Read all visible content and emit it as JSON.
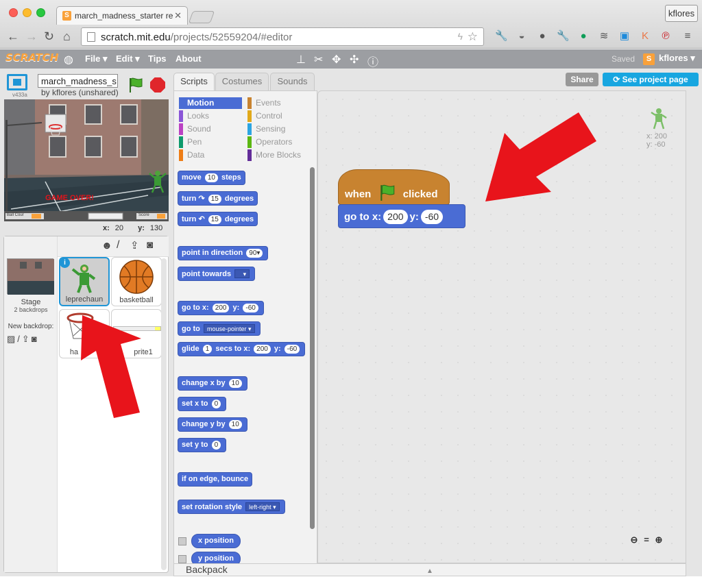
{
  "browser": {
    "tab_title": "march_madness_starter re",
    "url_domain": "scratch.mit.edu",
    "url_path": "/projects/52559204/#editor",
    "profile_name": "kflores"
  },
  "menubar": {
    "logo": "SCRATCH",
    "file_label": "File",
    "edit_label": "Edit",
    "tips_label": "Tips",
    "about_label": "About",
    "saved_label": "Saved",
    "username": "kflores"
  },
  "stage": {
    "version": "v433a",
    "project_name": "march_madness_s",
    "byline": "by kflores (unshared)",
    "game_over_text": "GAME OVER!",
    "ball_count_label": "Ball Cour",
    "score_label": "Score",
    "x_label": "x:",
    "x_value": "20",
    "y_label": "y:",
    "y_value": "130"
  },
  "sprites": {
    "stage_label": "Stage",
    "backdrops_label": "2 backdrops",
    "new_backdrop_label": "New backdrop:",
    "items": [
      {
        "name": "leprechaun"
      },
      {
        "name": "basketball"
      },
      {
        "name": "ha"
      },
      {
        "name": "prite1"
      }
    ]
  },
  "tabs": {
    "scripts": "Scripts",
    "costumes": "Costumes",
    "sounds": "Sounds"
  },
  "categories": [
    {
      "label": "Motion",
      "color": "#4a6cd4"
    },
    {
      "label": "Looks",
      "color": "#8a55d7"
    },
    {
      "label": "Sound",
      "color": "#bb42c3"
    },
    {
      "label": "Pen",
      "color": "#0e9a6c"
    },
    {
      "label": "Data",
      "color": "#ee7d16"
    },
    {
      "label": "Events",
      "color": "#c88330"
    },
    {
      "label": "Control",
      "color": "#e1a91a"
    },
    {
      "label": "Sensing",
      "color": "#2ca5e2"
    },
    {
      "label": "Operators",
      "color": "#5cb712"
    },
    {
      "label": "More Blocks",
      "color": "#632d99"
    }
  ],
  "blocks": {
    "move": "move",
    "move_val": "10",
    "steps": "steps",
    "turn": "turn",
    "turn_r_val": "15",
    "degrees": "degrees",
    "turn_l_val": "15",
    "point_dir": "point in direction",
    "point_dir_val": "90",
    "point_towards": "point towards",
    "goto_xy": "go to x:",
    "goto_x_val": "200",
    "y": "y:",
    "goto_y_val": "-60",
    "goto": "go to",
    "goto_target": "mouse-pointer",
    "glide": "glide",
    "glide_secs": "1",
    "secs_to_x": "secs to x:",
    "glide_x": "200",
    "glide_y": "-60",
    "change_x": "change x by",
    "change_x_val": "10",
    "set_x": "set x to",
    "set_x_val": "0",
    "change_y": "change y by",
    "change_y_val": "10",
    "set_y": "set y to",
    "set_y_val": "0",
    "bounce": "if on edge, bounce",
    "rotation": "set rotation style",
    "rotation_val": "left-right",
    "x_position": "x position",
    "y_position": "y position"
  },
  "script": {
    "hat_when": "when",
    "hat_clicked": "clicked",
    "goto_label": "go to x:",
    "x_val": "200",
    "y_label": "y:",
    "y_val": "-60"
  },
  "header_buttons": {
    "share": "Share",
    "see_project": "See project page"
  },
  "sprite_info": {
    "x": "x: 200",
    "y": "y: -60"
  },
  "backpack": "Backpack",
  "help": "?",
  "colors": {
    "motion": "#4a6cd4",
    "events": "#c88330",
    "arrow": "#e8141b",
    "share_blue": "#18a6e0"
  }
}
